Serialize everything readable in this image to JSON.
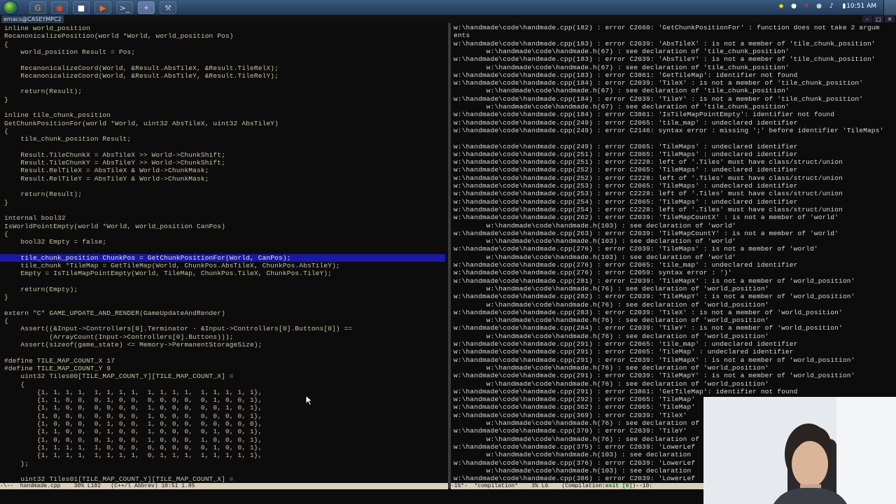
{
  "taskbar": {
    "window_caption": "emacs@CASEYMPC2",
    "clock": "10:51 AM",
    "buttons": [
      {
        "label": "G",
        "color": "#e8b018"
      },
      {
        "label": "●",
        "color": "#d04a2a"
      },
      {
        "label": "■",
        "color": "#ffffff"
      },
      {
        "label": "▶",
        "color": "#ff6a20"
      },
      {
        "label": ">_",
        "color": "#dddddd"
      },
      {
        "label": "✦",
        "color": "#c6a0ff"
      },
      {
        "label": "⚒",
        "color": "#bdb4ff"
      }
    ],
    "tray": [
      {
        "label": "◆",
        "color": "#ffd200"
      },
      {
        "label": "●",
        "color": "#ffffff"
      },
      {
        "label": "✕",
        "color": "#ff3030"
      },
      {
        "label": "●",
        "color": "#cccccc"
      },
      {
        "label": "♪",
        "color": "#ffffff"
      },
      {
        "label": "▮",
        "color": "#ffffff"
      }
    ]
  },
  "editor": {
    "code_lines": [
      "inline world_position",
      "RecanonicalizePosition(world *World, world_position Pos)",
      "{",
      "    world_position Result = Pos;",
      "",
      "    RecanonicalizeCoord(World, &Result.AbsTileX, &Result.TileRelX);",
      "    RecanonicalizeCoord(World, &Result.AbsTileY, &Result.TileRelY);",
      "",
      "    return(Result);",
      "}",
      "",
      "inline tile_chunk_position",
      "GetChunkPositionFor(world *World, uint32 AbsTileX, uint32 AbsTileY)",
      "{",
      "    tile_chunk_position Result;",
      "",
      "    Result.TileChunkX = AbsTileX >> World->ChunkShift;",
      "    Result.TileChunkY = AbsTileY >> World->ChunkShift;",
      "    Result.RelTileX = AbsTileX & World->ChunkMask;",
      "    Result.RelTileY = AbsTileY & World->ChunkMask;",
      "",
      "    return(Result);",
      "}",
      "",
      "internal bool32",
      "IsWorldPointEmpty(world *World, world_position CanPos)",
      "{",
      "    bool32 Empty = false;",
      "",
      "    tile_chunk_position ChunkPos = GetChunkPositionFor(World, CanPos);",
      "    tile_chunk *TileMap = GetTileMap(World, ChunkPos.AbsTileX, ChunkPos.AbsTileY);",
      "    Empty = IsTileMapPointEmpty(World, TileMap, ChunkPos.TileX, ChunkPos.TileY);",
      "",
      "    return(Empty);",
      "}",
      "",
      "extern \"C\" GAME_UPDATE_AND_RENDER(GameUpdateAndRender)",
      "{",
      "    Assert((&Input->Controllers[0].Terminator - &Input->Controllers[0].Buttons[0]) ==",
      "           (ArrayCount(Input->Controllers[0].Buttons)));",
      "    Assert(sizeof(game_state) <= Memory->PermanentStorageSize);",
      "",
      "#define TILE_MAP_COUNT_X 17",
      "#define TILE_MAP_COUNT_Y 9",
      "    uint32 Tiles00[TILE_MAP_COUNT_Y][TILE_MAP_COUNT_X] =",
      "    {",
      "        {1, 1, 1, 1,  1, 1, 1, 1,  1, 1, 1, 1,  1, 1, 1, 1, 1},",
      "        {1, 1, 0, 0,  0, 1, 0, 0,  0, 0, 0, 0,  0, 1, 0, 0, 1},",
      "        {1, 1, 0, 0,  0, 0, 0, 0,  1, 0, 0, 0,  0, 0, 1, 0, 1},",
      "        {1, 0, 0, 0,  0, 0, 0, 0,  1, 0, 0, 0,  0, 0, 0, 0, 1},",
      "        {1, 0, 0, 0,  0, 1, 0, 0,  1, 0, 0, 0,  0, 0, 0, 0, 0},",
      "        {1, 1, 0, 0,  0, 1, 0, 0,  1, 0, 0, 0,  0, 1, 0, 0, 1},",
      "        {1, 0, 0, 0,  0, 1, 0, 0,  1, 0, 0, 0,  1, 0, 0, 0, 1},",
      "        {1, 1, 1, 1,  1, 0, 0, 0,  0, 0, 0, 0,  0, 1, 0, 0, 1},",
      "        {1, 1, 1, 1,  1, 1, 1, 1,  0, 1, 1, 1,  1, 1, 1, 1, 1},",
      "    };",
      "",
      "    uint32 Tiles01[TILE_MAP_COUNT_Y][TILE_MAP_COUNT_X] ="
    ],
    "modeline": "-\\--  handmade.cpp    30% L182   (C++/l Abbrev) 10:51 1.85"
  },
  "compilation": {
    "lines": [
      "w:\\handmade\\code\\handmade.cpp(182) : error C2660: 'GetChunkPositionFor' : function does not take 2 argum",
      "ents",
      "w:\\handmade\\code\\handmade.cpp(183) : error C2039: 'AbsTileX' : is not a member of 'tile_chunk_position'",
      "        w:\\handmade\\code\\handmade.h(67) : see declaration of 'tile_chunk_position'",
      "w:\\handmade\\code\\handmade.cpp(183) : error C2039: 'AbsTileY' : is not a member of 'tile_chunk_position'",
      "        w:\\handmade\\code\\handmade.h(67) : see declaration of 'tile_chunk_position'",
      "w:\\handmade\\code\\handmade.cpp(183) : error C3861: 'GetTileMap': identifier not found",
      "w:\\handmade\\code\\handmade.cpp(184) : error C2039: 'TileX' : is not a member of 'tile_chunk_position'",
      "        w:\\handmade\\code\\handmade.h(67) : see declaration of 'tile_chunk_position'",
      "w:\\handmade\\code\\handmade.cpp(184) : error C2039: 'TileY' : is not a member of 'tile_chunk_position'",
      "        w:\\handmade\\code\\handmade.h(67) : see declaration of 'tile_chunk_position'",
      "w:\\handmade\\code\\handmade.cpp(184) : error C3861: 'IsTileMapPointEmpty': identifier not found",
      "w:\\handmade\\code\\handmade.cpp(249) : error C2065: 'tile_map' : undeclared identifier",
      "w:\\handmade\\code\\handmade.cpp(249) : error C2146: syntax error : missing ';' before identifier 'TileMaps'",
      "",
      "w:\\handmade\\code\\handmade.cpp(249) : error C2065: 'TileMaps' : undeclared identifier",
      "w:\\handmade\\code\\handmade.cpp(251) : error C2065: 'TileMaps' : undeclared identifier",
      "w:\\handmade\\code\\handmade.cpp(251) : error C2228: left of '.Tiles' must have class/struct/union",
      "w:\\handmade\\code\\handmade.cpp(252) : error C2065: 'TileMaps' : undeclared identifier",
      "w:\\handmade\\code\\handmade.cpp(252) : error C2228: left of '.Tiles' must have class/struct/union",
      "w:\\handmade\\code\\handmade.cpp(253) : error C2065: 'TileMaps' : undeclared identifier",
      "w:\\handmade\\code\\handmade.cpp(253) : error C2228: left of '.Tiles' must have class/struct/union",
      "w:\\handmade\\code\\handmade.cpp(254) : error C2065: 'TileMaps' : undeclared identifier",
      "w:\\handmade\\code\\handmade.cpp(254) : error C2228: left of '.Tiles' must have class/struct/union",
      "w:\\handmade\\code\\handmade.cpp(262) : error C2039: 'TileMapCountX' : is not a member of 'world'",
      "        w:\\handmade\\code\\handmade.h(103) : see declaration of 'world'",
      "w:\\handmade\\code\\handmade.cpp(263) : error C2039: 'TileMapCountY' : is not a member of 'world'",
      "        w:\\handmade\\code\\handmade.h(103) : see declaration of 'world'",
      "w:\\handmade\\code\\handmade.cpp(276) : error C2039: 'TileMaps' : is not a member of 'world'",
      "        w:\\handmade\\code\\handmade.h(103) : see declaration of 'world'",
      "w:\\handmade\\code\\handmade.cpp(276) : error C2065: 'tile_map' : undeclared identifier",
      "w:\\handmade\\code\\handmade.cpp(276) : error C2059: syntax error : ')'",
      "w:\\handmade\\code\\handmade.cpp(281) : error C2039: 'TileMapX' : is not a member of 'world_position'",
      "        w:\\handmade\\code\\handmade.h(76) : see declaration of 'world_position'",
      "w:\\handmade\\code\\handmade.cpp(282) : error C2039: 'TileMapY' : is not a member of 'world_position'",
      "        w:\\handmade\\code\\handmade.h(76) : see declaration of 'world_position'",
      "w:\\handmade\\code\\handmade.cpp(283) : error C2039: 'TileX' : is not a member of 'world_position'",
      "        w:\\handmade\\code\\handmade.h(76) : see declaration of 'world_position'",
      "w:\\handmade\\code\\handmade.cpp(284) : error C2039: 'TileY' : is not a member of 'world_position'",
      "        w:\\handmade\\code\\handmade.h(76) : see declaration of 'world_position'",
      "w:\\handmade\\code\\handmade.cpp(291) : error C2065: 'tile_map' : undeclared identifier",
      "w:\\handmade\\code\\handmade.cpp(291) : error C2065: 'TileMap' : undeclared identifier",
      "w:\\handmade\\code\\handmade.cpp(291) : error C2039: 'TileMapX' : is not a member of 'world_position'",
      "        w:\\handmade\\code\\handmade.h(76) : see declaration of 'world_position'",
      "w:\\handmade\\code\\handmade.cpp(291) : error C2039: 'TileMapY' : is not a member of 'world_position'",
      "        w:\\handmade\\code\\handmade.h(76) : see declaration of 'world_position'",
      "w:\\handmade\\code\\handmade.cpp(291) : error C3861: 'GetTileMap': identifier not found",
      "w:\\handmade\\code\\handmade.cpp(292) : error C2065: 'TileMap'",
      "w:\\handmade\\code\\handmade.cpp(362) : error C2065: 'TileMap'",
      "w:\\handmade\\code\\handmade.cpp(369) : error C2039: 'TileX'",
      "        w:\\handmade\\code\\handmade.h(76) : see declaration of",
      "w:\\handmade\\code\\handmade.cpp(370) : error C2039: 'TileY'",
      "        w:\\handmade\\code\\handmade.h(76) : see declaration of",
      "w:\\handmade\\code\\handmade.cpp(375) : error C2039: 'LowerLef",
      "        w:\\handmade\\code\\handmade.h(103) : see declaration",
      "w:\\handmade\\code\\handmade.cpp(376) : error C2039: 'LowerLef",
      "        w:\\handmade\\code\\handmade.h(103) : see declaration",
      "w:\\handmade\\code\\handmade.cpp(386) : error C2039: 'LowerLef"
    ],
    "modeline_left": "-1%*-  *compilation*    3% L6    (Compilation:",
    "modeline_exit": "exit [0]",
    "modeline_right": ")--10:"
  }
}
